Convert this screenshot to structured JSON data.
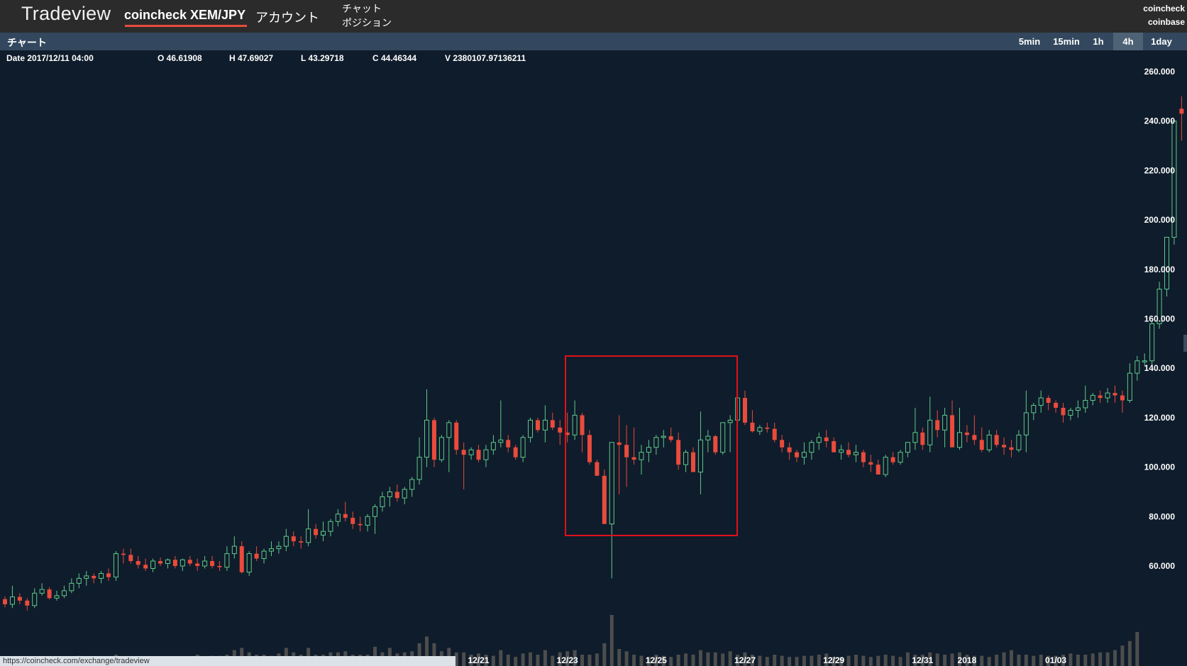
{
  "header": {
    "brand": "Tradeview",
    "market": "coincheck XEM/JPY",
    "account": "アカウント",
    "chat": "チャット",
    "positions": "ポジション",
    "exchanges": [
      "coincheck",
      "coinbase"
    ]
  },
  "toolbar": {
    "title": "チャート",
    "timeframes": [
      "5min",
      "15min",
      "1h",
      "4h",
      "1day"
    ],
    "active_timeframe": "4h"
  },
  "ohlc": {
    "date_label": "Date 2017/12/11 04:00",
    "open": "O 46.61908",
    "high": "H 47.69027",
    "low": "L 43.29718",
    "close": "C 44.46344",
    "volume": "V 2380107.97136211"
  },
  "status_url": "https://coincheck.com/exchange/tradeview",
  "colors": {
    "background": "#0f1c2b",
    "up": "#5fc98a",
    "down": "#e94b3c",
    "volume": "#4d4d4d",
    "highlight_box": "#e0101a"
  },
  "chart_data": {
    "type": "candlestick",
    "title": "",
    "ylim": [
      40,
      265
    ],
    "y_ticks": [
      60,
      80,
      100,
      120,
      140,
      160,
      180,
      200,
      220,
      240,
      260
    ],
    "y_tick_labels": [
      "60.000",
      "80.000",
      "100.000",
      "120.000",
      "140.000",
      "160.000",
      "180.000",
      "200.000",
      "220.000",
      "240.000",
      "260.000"
    ],
    "x_tick_labels": [
      "12/21",
      "12/23",
      "12/25",
      "12/27",
      "12/29",
      "12/31",
      "2018",
      "01/03"
    ],
    "x_tick_candle_index": [
      64,
      76,
      88,
      100,
      112,
      124,
      130,
      142
    ],
    "grid": false,
    "candles": [
      [
        46.6,
        47.7,
        43.3,
        44.5
      ],
      [
        44.5,
        52,
        43,
        47.5
      ],
      [
        47.5,
        49,
        44.5,
        46
      ],
      [
        46,
        47,
        42,
        44
      ],
      [
        44,
        51,
        43,
        49
      ],
      [
        49,
        53,
        48,
        50.5
      ],
      [
        50.5,
        51.5,
        46.5,
        47
      ],
      [
        47,
        50,
        46,
        48
      ],
      [
        48,
        52,
        47,
        50
      ],
      [
        50,
        55,
        49,
        53
      ],
      [
        53,
        57,
        51,
        55
      ],
      [
        55,
        58,
        52,
        56
      ],
      [
        56,
        57,
        53,
        55
      ],
      [
        55,
        58,
        53,
        57
      ],
      [
        57,
        59,
        54,
        55.5
      ],
      [
        55.5,
        66,
        54,
        65
      ],
      [
        65,
        67,
        61,
        64.5
      ],
      [
        64.5,
        67,
        61,
        62
      ],
      [
        62,
        64,
        59,
        60.5
      ],
      [
        60.5,
        63,
        58,
        59
      ],
      [
        59,
        63,
        57.5,
        62
      ],
      [
        62,
        63.5,
        60,
        61
      ],
      [
        61,
        63,
        59,
        62.5
      ],
      [
        62.5,
        64,
        59,
        60
      ],
      [
        60,
        63,
        58,
        62.5
      ],
      [
        62.5,
        64,
        60,
        61
      ],
      [
        61,
        63,
        58,
        60
      ],
      [
        60,
        64,
        59,
        62
      ],
      [
        62,
        64,
        59,
        60
      ],
      [
        60,
        62,
        58,
        59.5
      ],
      [
        59.5,
        68,
        58,
        65
      ],
      [
        65,
        72,
        63,
        68
      ],
      [
        68,
        70,
        57,
        57.5
      ],
      [
        57.5,
        66,
        56,
        65
      ],
      [
        65,
        68,
        62,
        63
      ],
      [
        63,
        67,
        61,
        66
      ],
      [
        66,
        70,
        64,
        67
      ],
      [
        67,
        70,
        65,
        68
      ],
      [
        68,
        75,
        66,
        72
      ],
      [
        72,
        74,
        68,
        70
      ],
      [
        70,
        72,
        67,
        69.5
      ],
      [
        69.5,
        83,
        68,
        75
      ],
      [
        75,
        77,
        71,
        72.5
      ],
      [
        72.5,
        78,
        70,
        74
      ],
      [
        74,
        79,
        72,
        78
      ],
      [
        78,
        83,
        76,
        81
      ],
      [
        81,
        86,
        78,
        79.5
      ],
      [
        79.5,
        82,
        75,
        77
      ],
      [
        77,
        80,
        74,
        76.5
      ],
      [
        76.5,
        81,
        74,
        80
      ],
      [
        80,
        85,
        73,
        84
      ],
      [
        84,
        90,
        82,
        88
      ],
      [
        88,
        92,
        84,
        90
      ],
      [
        90,
        93,
        86,
        87.5
      ],
      [
        87.5,
        92,
        85,
        91
      ],
      [
        91,
        96,
        88,
        95
      ],
      [
        95,
        112,
        93,
        104
      ],
      [
        104,
        131.5,
        100,
        119
      ],
      [
        119,
        120,
        100,
        103
      ],
      [
        103,
        113,
        102,
        112
      ],
      [
        112,
        119,
        98,
        118
      ],
      [
        118,
        119,
        105,
        107
      ],
      [
        107,
        110,
        91,
        105
      ],
      [
        105,
        108,
        103,
        107
      ],
      [
        107,
        109,
        102,
        103
      ],
      [
        103,
        109,
        100,
        107
      ],
      [
        107,
        113,
        105,
        110
      ],
      [
        110,
        127,
        108,
        111
      ],
      [
        111,
        113,
        106,
        108
      ],
      [
        108,
        109,
        103,
        104
      ],
      [
        104,
        113,
        102,
        112
      ],
      [
        112,
        120,
        110,
        119
      ],
      [
        119,
        120,
        114,
        115
      ],
      [
        115,
        125,
        110,
        119
      ],
      [
        119,
        122,
        115,
        116
      ],
      [
        116,
        119,
        109,
        114
      ],
      [
        114,
        122,
        110,
        113
      ],
      [
        113,
        127,
        111,
        121
      ],
      [
        121,
        122,
        106,
        113
      ],
      [
        113,
        115,
        101,
        102
      ],
      [
        102,
        103,
        97,
        96.5
      ],
      [
        96.5,
        99,
        83,
        77
      ],
      [
        77,
        105,
        55,
        110
      ],
      [
        110,
        121,
        89,
        109
      ],
      [
        109,
        117,
        92,
        104
      ],
      [
        104,
        116,
        101,
        103
      ],
      [
        103,
        109,
        97,
        106
      ],
      [
        106,
        111,
        102,
        108
      ],
      [
        108,
        113,
        105,
        112
      ],
      [
        112,
        115,
        108,
        112.5
      ],
      [
        112.5,
        116,
        110,
        111
      ],
      [
        111,
        114,
        99,
        101
      ],
      [
        101,
        107,
        98,
        106
      ],
      [
        106,
        108,
        98,
        98
      ],
      [
        98,
        122.5,
        89,
        111
      ],
      [
        111,
        115,
        106,
        112.5
      ],
      [
        112.5,
        113,
        105,
        106
      ],
      [
        106,
        118,
        105,
        118
      ],
      [
        118,
        121,
        106,
        119
      ],
      [
        119,
        130,
        116,
        128
      ],
      [
        128,
        131,
        117,
        118
      ],
      [
        118,
        123,
        114,
        114.5
      ],
      [
        114.5,
        117,
        113,
        116
      ],
      [
        116,
        118,
        114,
        115.5
      ],
      [
        115.5,
        118,
        110,
        111
      ],
      [
        111,
        113,
        106,
        108
      ],
      [
        108,
        110,
        103,
        106
      ],
      [
        106,
        107,
        102,
        104
      ],
      [
        104,
        110,
        101,
        106
      ],
      [
        106,
        111,
        103,
        110
      ],
      [
        110,
        114,
        107,
        112
      ],
      [
        112,
        115,
        108,
        110.5
      ],
      [
        110.5,
        112,
        106,
        106
      ],
      [
        106,
        109,
        103,
        107
      ],
      [
        107,
        110,
        104,
        105
      ],
      [
        105,
        109,
        102,
        106
      ],
      [
        106,
        107,
        100,
        102
      ],
      [
        102,
        105,
        98,
        101
      ],
      [
        101,
        103,
        97,
        97
      ],
      [
        97,
        105,
        96,
        104
      ],
      [
        104,
        106,
        101,
        102
      ],
      [
        102,
        107,
        101,
        106
      ],
      [
        106,
        110,
        104,
        110
      ],
      [
        110,
        124,
        107,
        114
      ],
      [
        114,
        116,
        107,
        109
      ],
      [
        109,
        128.5,
        106,
        119
      ],
      [
        119,
        123,
        112,
        115
      ],
      [
        115,
        124,
        108,
        121
      ],
      [
        121,
        127,
        114,
        108
      ],
      [
        108,
        124,
        107,
        114
      ],
      [
        114,
        117,
        110,
        113
      ],
      [
        113,
        121,
        109,
        111
      ],
      [
        111,
        116,
        106,
        107
      ],
      [
        107,
        115,
        106,
        113
      ],
      [
        113,
        115,
        108,
        109
      ],
      [
        109,
        112,
        105,
        108
      ],
      [
        108,
        111,
        104,
        107
      ],
      [
        107,
        115,
        106,
        113
      ],
      [
        113,
        131,
        106,
        122
      ],
      [
        122,
        126,
        119,
        125
      ],
      [
        125,
        131,
        122,
        128
      ],
      [
        128,
        129,
        123,
        126
      ],
      [
        126,
        127,
        122,
        124
      ],
      [
        124,
        126,
        118,
        121
      ],
      [
        121,
        124,
        119,
        123
      ],
      [
        123,
        127,
        120,
        124
      ],
      [
        124,
        133,
        122,
        127
      ],
      [
        127,
        130,
        125,
        129
      ],
      [
        129,
        131,
        126,
        128
      ],
      [
        128,
        132,
        126,
        130
      ],
      [
        130,
        133,
        126,
        129
      ],
      [
        129,
        131,
        122,
        127
      ],
      [
        127,
        142,
        126,
        138
      ],
      [
        138,
        145,
        135,
        143
      ],
      [
        143,
        146,
        141,
        143
      ],
      [
        143,
        159,
        141,
        158
      ],
      [
        158,
        175,
        156,
        172
      ],
      [
        172,
        190,
        169,
        193
      ],
      [
        193,
        202,
        190,
        240
      ],
      [
        245,
        250,
        232,
        243
      ]
    ],
    "volumes": [
      0.2,
      0.3,
      0.3,
      0.3,
      0.5,
      0.6,
      0.6,
      0.7,
      0.5,
      0.7,
      0.9,
      0.8,
      0.6,
      0.7,
      0.8,
      1.0,
      0.6,
      0.8,
      0.7,
      0.7,
      0.8,
      0.7,
      0.7,
      0.8,
      0.8,
      0.8,
      1.0,
      0.8,
      0.9,
      0.9,
      1.0,
      1.4,
      1.6,
      1.2,
      1.0,
      1.0,
      0.9,
      1.1,
      1.6,
      1.2,
      1.0,
      1.6,
      1.0,
      1.0,
      1.2,
      1.2,
      1.3,
      1.0,
      1.0,
      1.0,
      1.7,
      1.2,
      1.6,
      1.1,
      1.2,
      1.3,
      2.0,
      2.6,
      2.0,
      1.3,
      1.6,
      1.2,
      1.2,
      1.0,
      1.1,
      1.0,
      0.9,
      1.4,
      1.0,
      0.8,
      1.1,
      1.2,
      1.0,
      1.4,
      0.9,
      1.2,
      1.3,
      1.4,
      1.0,
      1.0,
      1.1,
      2.0,
      4.5,
      1.5,
      1.3,
      1.0,
      0.9,
      0.8,
      1.0,
      0.9,
      0.8,
      1.0,
      1.1,
      1.0,
      1.4,
      1.2,
      1.2,
      1.1,
      1.3,
      1.0,
      1.2,
      1.0,
      0.9,
      0.8,
      1.0,
      0.9,
      0.8,
      0.8,
      0.9,
      0.9,
      1.0,
      1.1,
      0.8,
      0.8,
      0.9,
      1.0,
      0.9,
      0.8,
      0.9,
      1.0,
      0.9,
      0.8,
      1.2,
      1.0,
      1.0,
      1.2,
      1.1,
      1.0,
      1.1,
      1.2,
      1.0,
      0.9,
      0.9,
      0.8,
      1.0,
      1.2,
      1.4,
      1.0,
      1.0,
      0.9,
      1.0,
      0.9,
      0.9,
      1.0,
      1.1,
      1.0,
      1.0,
      1.1,
      1.2,
      1.2,
      1.4,
      1.8,
      2.2,
      3.0
    ]
  }
}
